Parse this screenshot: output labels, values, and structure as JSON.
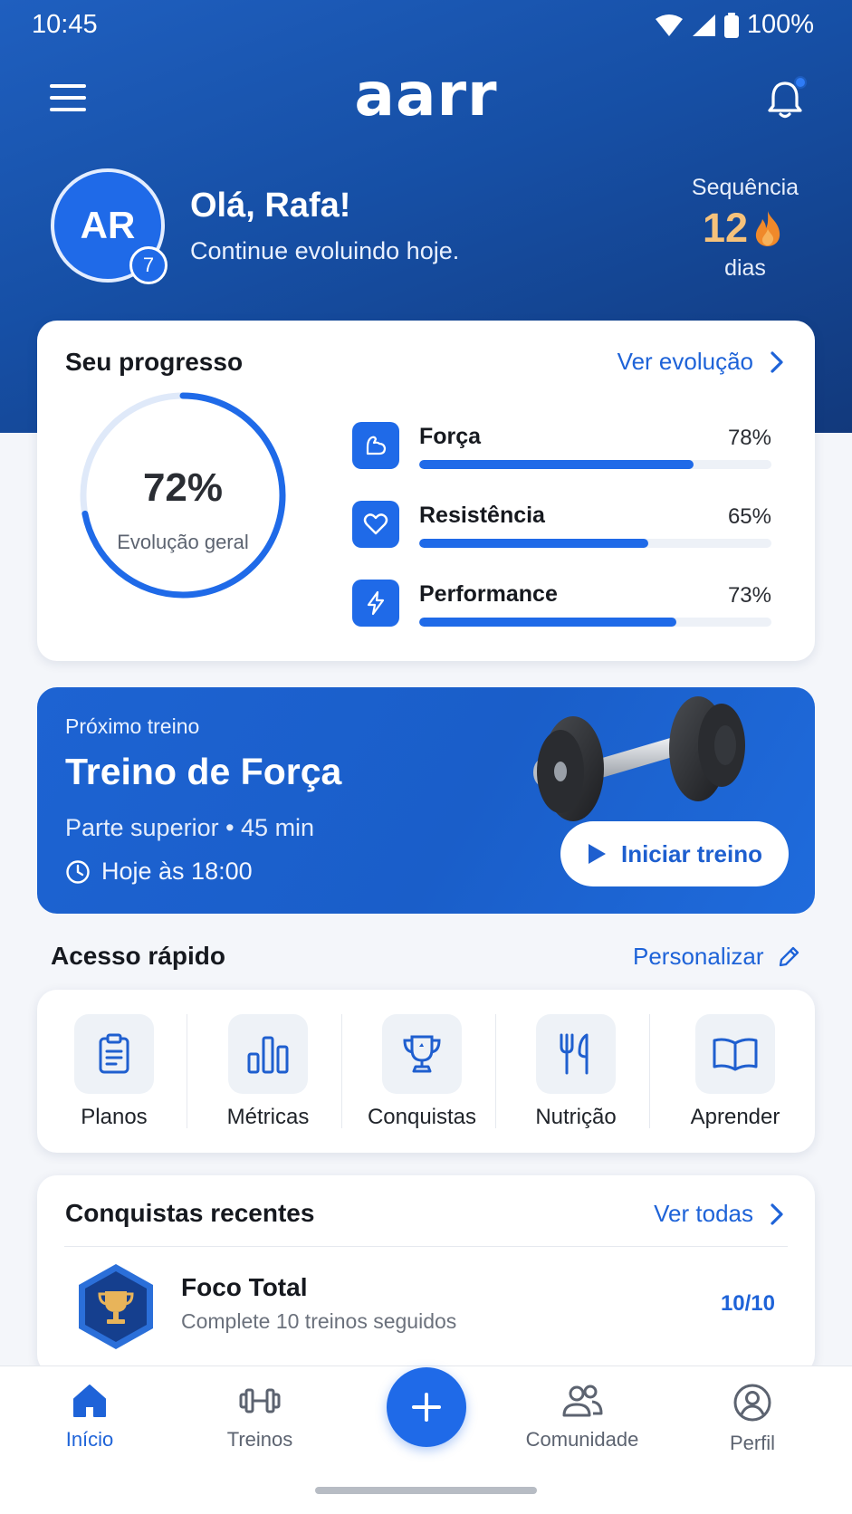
{
  "status_bar": {
    "time": "10:45",
    "battery": "100%"
  },
  "header": {
    "logo": "aarr"
  },
  "profile": {
    "initials": "AR",
    "level": "7",
    "greeting": "Olá, Rafa!",
    "subtitle": "Continue evoluindo hoje.",
    "streak_label": "Sequência",
    "streak_value": "12",
    "streak_unit": "dias"
  },
  "progress": {
    "title": "Seu progresso",
    "link": "Ver evolução",
    "overall_value": "72%",
    "overall_fraction": 0.72,
    "overall_label": "Evolução geral",
    "metrics": [
      {
        "name": "Força",
        "percent_text": "78%",
        "fraction": 0.78,
        "icon": "muscle-icon"
      },
      {
        "name": "Resistência",
        "percent_text": "65%",
        "fraction": 0.65,
        "icon": "heart-icon"
      },
      {
        "name": "Performance",
        "percent_text": "73%",
        "fraction": 0.73,
        "icon": "lightning-icon"
      }
    ]
  },
  "next_workout": {
    "label": "Próximo treino",
    "title": "Treino de Força",
    "meta": "Parte superior • 45 min",
    "time": "Hoje às 18:00",
    "button": "Iniciar treino"
  },
  "quick_access": {
    "title": "Acesso rápido",
    "link": "Personalizar",
    "items": [
      {
        "label": "Planos",
        "icon": "clipboard-icon"
      },
      {
        "label": "Métricas",
        "icon": "bar-chart-icon"
      },
      {
        "label": "Conquistas",
        "icon": "trophy-icon"
      },
      {
        "label": "Nutrição",
        "icon": "utensils-icon"
      },
      {
        "label": "Aprender",
        "icon": "book-icon"
      }
    ]
  },
  "achievements": {
    "title": "Conquistas recentes",
    "link": "Ver todas",
    "items": [
      {
        "name": "Foco Total",
        "description": "Complete 10 treinos seguidos",
        "count": "10/10",
        "icon": "trophy-badge-icon"
      }
    ]
  },
  "bottom_nav": {
    "items": [
      {
        "label": "Início",
        "icon": "home-icon",
        "active": true
      },
      {
        "label": "Treinos",
        "icon": "dumbbell-icon",
        "active": false
      },
      {
        "label": "Comunidade",
        "icon": "community-icon",
        "active": false
      },
      {
        "label": "Perfil",
        "icon": "profile-icon",
        "active": false
      }
    ],
    "fab_icon": "plus-icon"
  },
  "colors": {
    "brand": "#1f6ae8",
    "header_dark": "#12397c",
    "streak": "#f6c27b",
    "link": "#1e63d8"
  }
}
